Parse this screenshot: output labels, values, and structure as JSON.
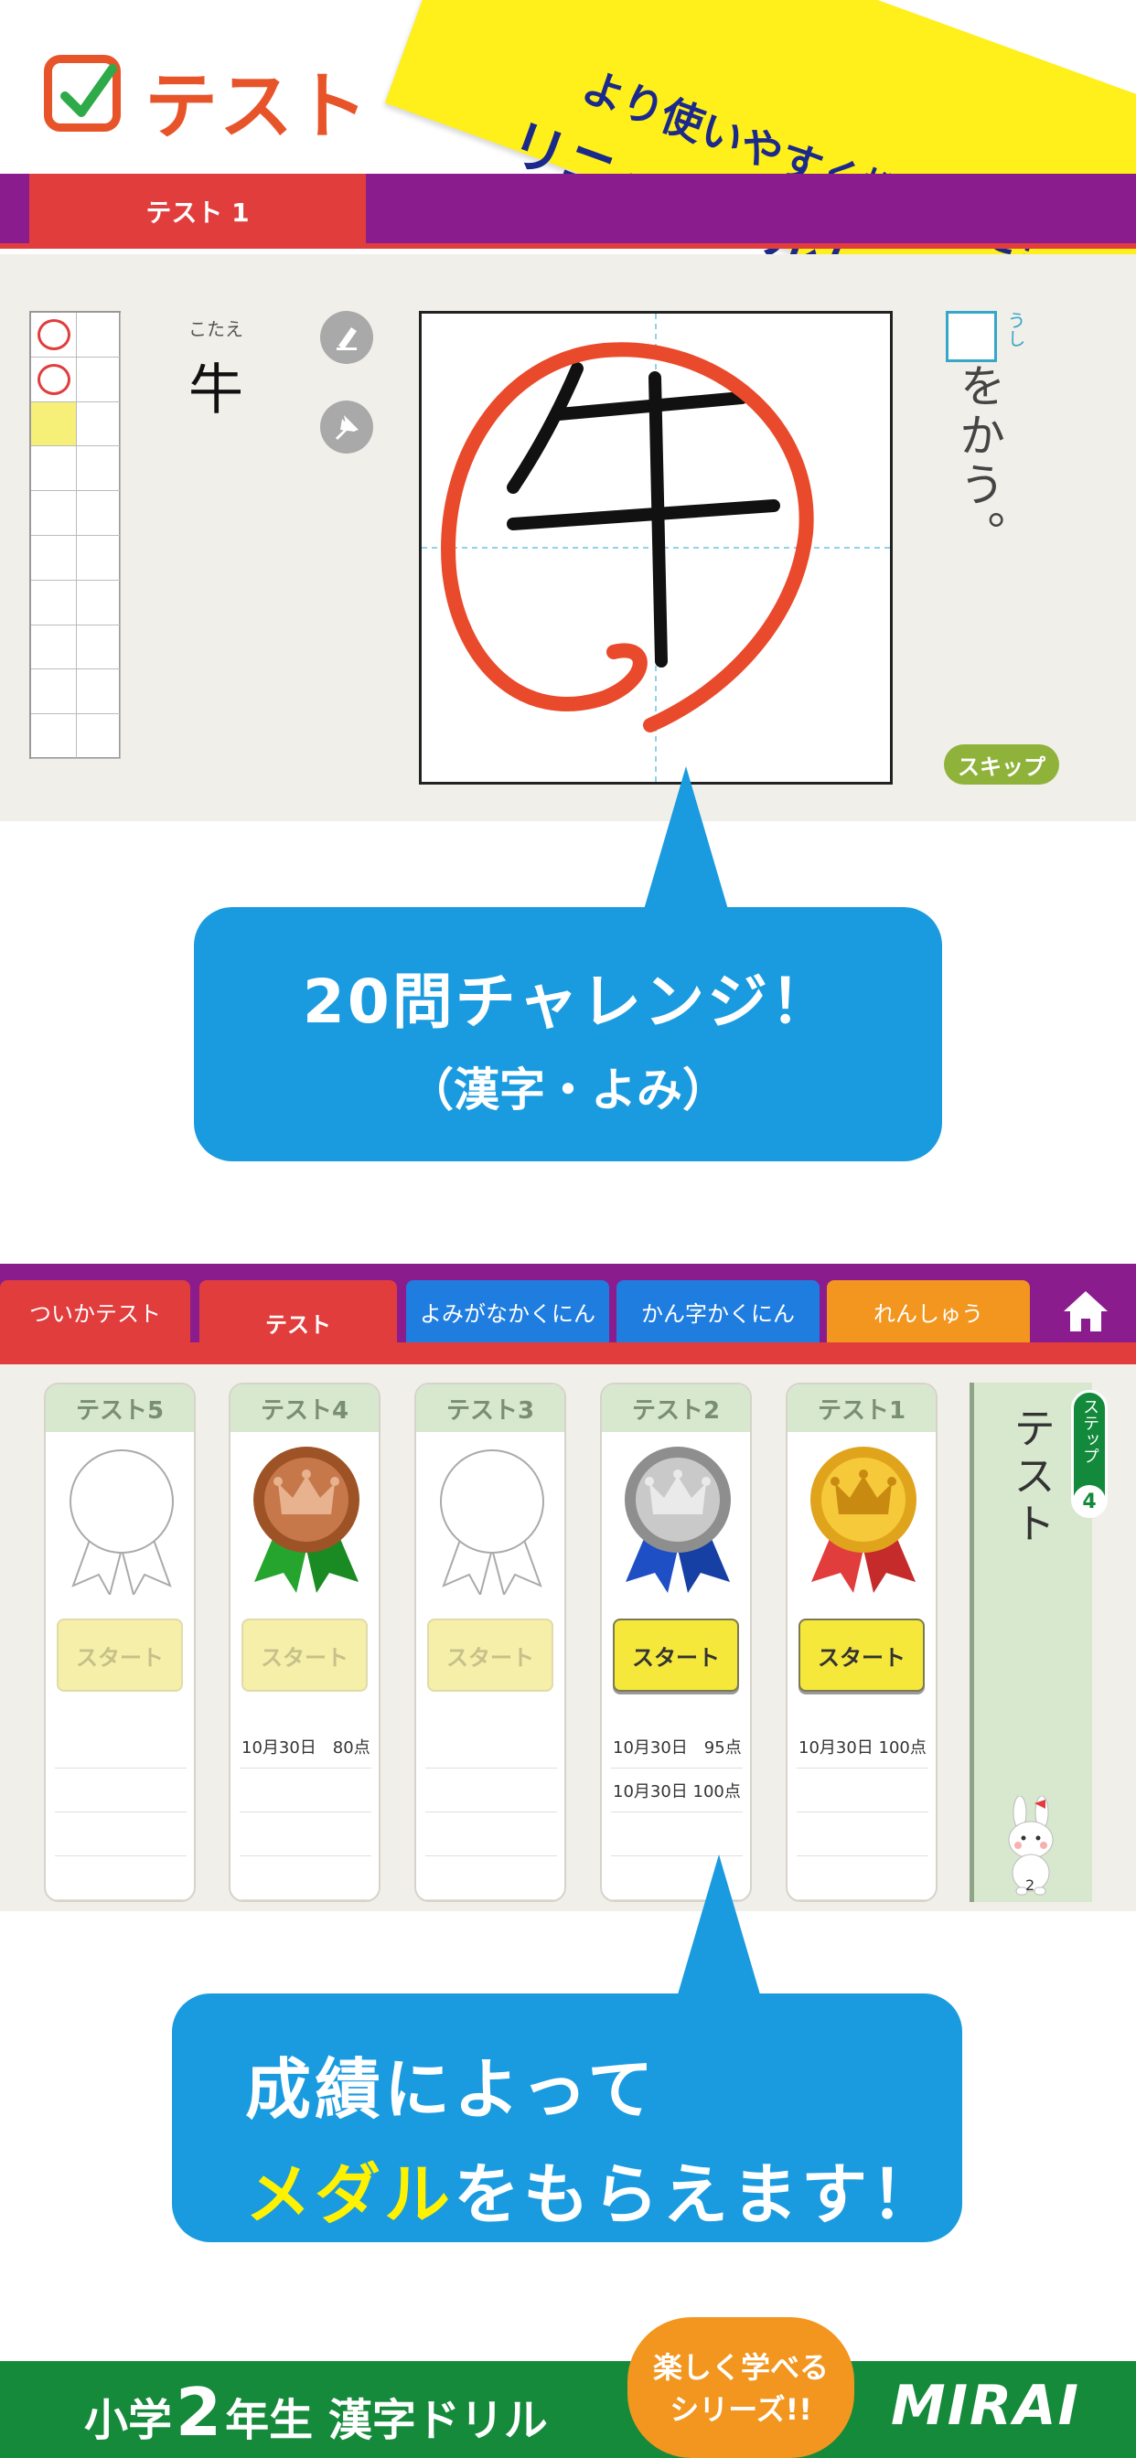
{
  "header": {
    "title": "テスト",
    "banner_line1": "より使いやすく機能的に！",
    "banner_line2": "リニューアルしました！"
  },
  "test_screen": {
    "tab_label": "テスト 1",
    "answer_label": "こたえ",
    "answer_value": "牛",
    "question_ruby": "うし",
    "question_text": "をかう。",
    "skip_label": "スキップ",
    "results": [
      "correct",
      "correct",
      "current",
      "",
      "",
      "",
      "",
      "",
      "",
      ""
    ]
  },
  "callout1": {
    "line1": "20問チャレンジ！",
    "line2": "（漢字・よみ）"
  },
  "medal_screen": {
    "tabs": [
      {
        "label": "ついかテスト",
        "color": "#e23d3d"
      },
      {
        "label": "テスト",
        "color": "#e23d3d"
      },
      {
        "label": "よみがなかくにん",
        "color": "#1f7de0"
      },
      {
        "label": "かん字かくにん",
        "color": "#1f7de0"
      },
      {
        "label": "れんしゅう",
        "color": "#f2961f"
      }
    ],
    "columns": [
      {
        "title": "テスト5",
        "medal": "none",
        "start": "スタート",
        "active": false,
        "scores": []
      },
      {
        "title": "テスト4",
        "medal": "bronze",
        "start": "スタート",
        "active": false,
        "scores": [
          "10月30日　80点"
        ]
      },
      {
        "title": "テスト3",
        "medal": "none",
        "start": "スタート",
        "active": false,
        "scores": []
      },
      {
        "title": "テスト2",
        "medal": "silver",
        "start": "スタート",
        "active": true,
        "scores": [
          "10月30日　95点",
          "10月30日 100点"
        ]
      },
      {
        "title": "テスト1",
        "medal": "gold",
        "start": "スタート",
        "active": true,
        "scores": [
          "10月30日 100点"
        ]
      }
    ],
    "side_title": "テスト",
    "step_label": "ステップ",
    "step_number": "4",
    "mascot_badge": "2"
  },
  "callout2": {
    "line1": "成績によって",
    "line2_highlight": "メダル",
    "line2_rest": "をもらえます！"
  },
  "footer": {
    "prefix": "小学",
    "grade": "2",
    "suffix": "年生 漢字ドリル",
    "badge_line1": "楽しく学べる",
    "badge_line2": "シリーズ!!",
    "logo": "MIRAI"
  },
  "colors": {
    "purple": "#8b1c8d",
    "red": "#e23d3d",
    "blue": "#1a9be0",
    "green": "#148a3a",
    "orange": "#f2961f",
    "yellow": "#ffef1a"
  }
}
